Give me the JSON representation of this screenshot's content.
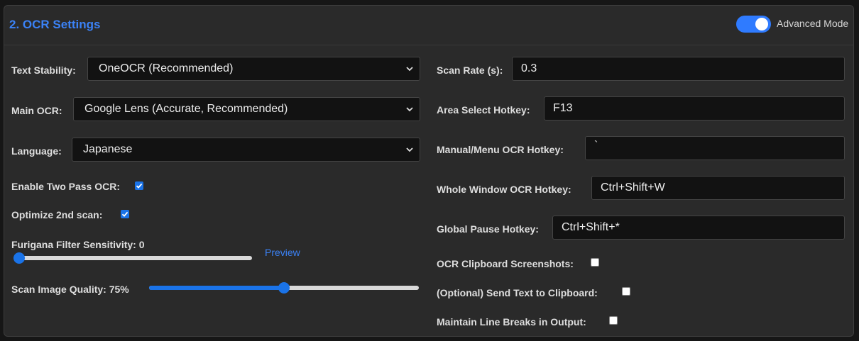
{
  "section": {
    "title": "2. OCR Settings",
    "advanced_mode": {
      "label": "Advanced Mode",
      "enabled": true
    }
  },
  "left": {
    "text_stability": {
      "label": "Text Stability:",
      "value": "OneOCR (Recommended)"
    },
    "main_ocr": {
      "label": "Main OCR:",
      "value": "Google Lens (Accurate, Recommended)"
    },
    "language": {
      "label": "Language:",
      "value": "Japanese"
    },
    "two_pass": {
      "label": "Enable Two Pass OCR:",
      "checked": true
    },
    "optimize_second": {
      "label": "Optimize 2nd scan:",
      "checked": true
    },
    "furigana": {
      "label": "Furigana Filter Sensitivity: 0",
      "value": 0,
      "fraction": 0.0,
      "preview_label": "Preview"
    },
    "image_quality": {
      "label": "Scan Image Quality: 75%",
      "value": 75,
      "fraction": 0.5
    }
  },
  "right": {
    "scan_rate": {
      "label": "Scan Rate (s):",
      "value": "0.3"
    },
    "area_select_hotkey": {
      "label": "Area Select Hotkey:",
      "value": "F13"
    },
    "manual_hotkey": {
      "label": "Manual/Menu OCR Hotkey:",
      "value": "`"
    },
    "whole_window_hotkey": {
      "label": "Whole Window OCR Hotkey:",
      "value": "Ctrl+Shift+W"
    },
    "global_pause_hotkey": {
      "label": "Global Pause Hotkey:",
      "value": "Ctrl+Shift+*"
    },
    "clipboard_screenshots": {
      "label": "OCR Clipboard Screenshots:",
      "checked": false
    },
    "send_to_clipboard": {
      "label": "(Optional) Send Text to Clipboard:",
      "checked": false
    },
    "maintain_line_breaks": {
      "label": "Maintain Line Breaks in Output:",
      "checked": false
    }
  },
  "colors": {
    "accent": "#3b82f6",
    "panel": "#2a2a2a",
    "input_bg": "#121212"
  }
}
